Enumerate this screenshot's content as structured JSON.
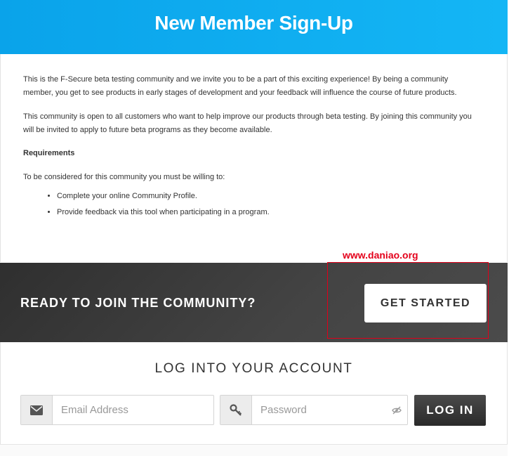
{
  "header": {
    "title": "New Member Sign-Up"
  },
  "intro": {
    "paragraph1": "This is the F-Secure beta testing community and we invite you to be a part of this exciting experience! By being a community member, you get to see products in early stages of development and your feedback will influence the course of future products.",
    "paragraph2": "This community is open to all customers who want to help improve our products through beta testing. By joining this community you will be invited to apply to future beta programs as they become available.",
    "requirements_heading": "Requirements",
    "requirements_lead": "To be considered for this community you must be willing to:",
    "requirements": [
      "Complete your online Community Profile.",
      "Provide feedback via this tool when participating in a program."
    ]
  },
  "watermark": "www.daniao.org",
  "join_band": {
    "heading": "READY TO JOIN THE COMMUNITY?",
    "button_label": "GET STARTED"
  },
  "login": {
    "title": "LOG INTO YOUR ACCOUNT",
    "email_placeholder": "Email Address",
    "password_placeholder": "Password",
    "button_label": "LOG IN",
    "icons": {
      "email": "envelope-icon",
      "password": "key-icon",
      "reveal": "eye-slash-icon"
    }
  },
  "colors": {
    "header_bg": "#14b6f5",
    "band_bg": "#3a3a3a",
    "highlight": "#e0001a"
  }
}
